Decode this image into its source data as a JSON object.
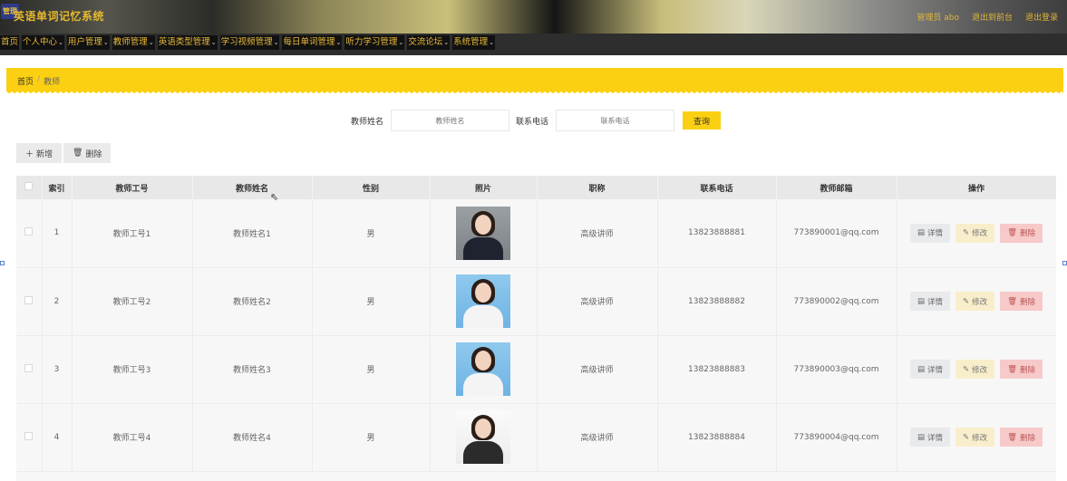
{
  "header": {
    "logo_text": "管理",
    "title": "英语单词记忆系统",
    "links": [
      "管理员 abo",
      "退出到前台",
      "退出登录"
    ]
  },
  "nav": {
    "items": [
      {
        "label": "首页",
        "has_dropdown": false
      },
      {
        "label": "个人中心",
        "has_dropdown": true
      },
      {
        "label": "用户管理",
        "has_dropdown": true
      },
      {
        "label": "教师管理",
        "has_dropdown": true
      },
      {
        "label": "英语类型管理",
        "has_dropdown": true
      },
      {
        "label": "学习视频管理",
        "has_dropdown": true
      },
      {
        "label": "每日单词管理",
        "has_dropdown": true
      },
      {
        "label": "听力学习管理",
        "has_dropdown": true
      },
      {
        "label": "交流论坛",
        "has_dropdown": true
      },
      {
        "label": "系统管理",
        "has_dropdown": true
      }
    ],
    "dropdown_icon": "chevron-down-icon"
  },
  "breadcrumb": {
    "home": "首页",
    "separator": "/",
    "current": "教师"
  },
  "search": {
    "name_label": "教师姓名",
    "name_placeholder": "教师姓名",
    "phone_label": "联系电话",
    "phone_placeholder": "联系电话",
    "button": "查询"
  },
  "toolbar": {
    "add": "新增",
    "delete": "删除"
  },
  "table": {
    "columns": [
      "",
      "索引",
      "教师工号",
      "教师姓名",
      "性别",
      "照片",
      "职称",
      "联系电话",
      "教师邮箱",
      "操作"
    ],
    "rows": [
      {
        "index": "1",
        "job_no": "教师工号1",
        "name": "教师姓名1",
        "gender": "男",
        "photo": "male-suit",
        "title": "高级讲师",
        "phone": "13823888881",
        "email": "773890001@qq.com"
      },
      {
        "index": "2",
        "job_no": "教师工号2",
        "name": "教师姓名2",
        "gender": "男",
        "photo": "female-blue",
        "title": "高级讲师",
        "phone": "13823888882",
        "email": "773890002@qq.com"
      },
      {
        "index": "3",
        "job_no": "教师工号3",
        "name": "教师姓名3",
        "gender": "男",
        "photo": "female-blue",
        "title": "高级讲师",
        "phone": "13823888883",
        "email": "773890003@qq.com"
      },
      {
        "index": "4",
        "job_no": "教师工号4",
        "name": "教师姓名4",
        "gender": "男",
        "photo": "female-white",
        "title": "高级讲师",
        "phone": "13823888884",
        "email": "773890004@qq.com"
      }
    ],
    "actions": {
      "detail": "详情",
      "edit": "修改",
      "delete": "删除"
    }
  },
  "colors": {
    "accent": "#fcd012",
    "nav_text": "#e8b93a",
    "delete_bg": "#f7c9c9",
    "edit_bg": "#f9eecb"
  }
}
